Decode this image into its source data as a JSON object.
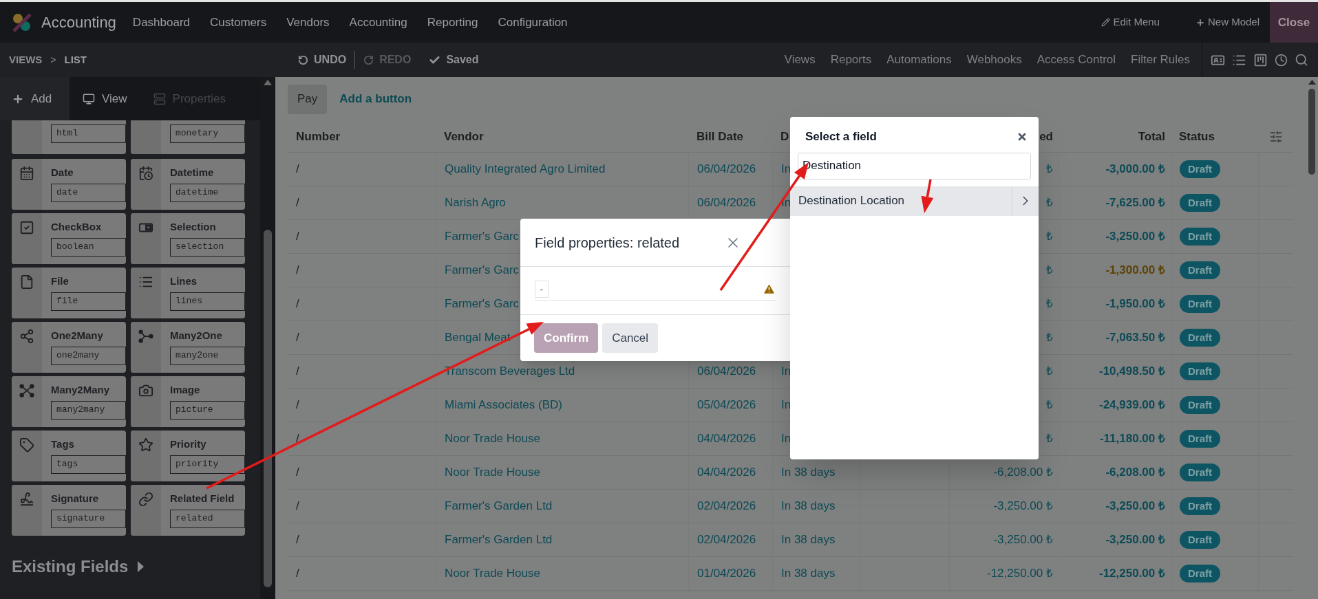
{
  "top_nav": {
    "app_name": "Accounting",
    "menu": [
      "Dashboard",
      "Customers",
      "Vendors",
      "Accounting",
      "Reporting",
      "Configuration"
    ],
    "edit_menu": "Edit Menu",
    "new_model": "New Model",
    "close": "Close"
  },
  "studio_bar": {
    "breadcrumb": [
      "VIEWS",
      "LIST"
    ],
    "separator": ">",
    "undo": {
      "label": "UNDO",
      "disabled": false
    },
    "redo": {
      "label": "REDO",
      "disabled": true
    },
    "status": "Saved",
    "links": [
      "Views",
      "Reports",
      "Automations",
      "Webhooks",
      "Access Control",
      "Filter Rules"
    ]
  },
  "sidebar": {
    "tabs": [
      {
        "label": "Add",
        "selected": true,
        "disabled": false
      },
      {
        "label": "View",
        "selected": false,
        "disabled": false
      },
      {
        "label": "Properties",
        "selected": false,
        "disabled": true
      }
    ],
    "fields": [
      {
        "type": "html"
      },
      {
        "type": "monetary"
      },
      {
        "label": "Date",
        "type": "date"
      },
      {
        "label": "Datetime",
        "type": "datetime"
      },
      {
        "label": "CheckBox",
        "type": "boolean"
      },
      {
        "label": "Selection",
        "type": "selection"
      },
      {
        "label": "File",
        "type": "file"
      },
      {
        "label": "Lines",
        "type": "lines"
      },
      {
        "label": "One2Many",
        "type": "one2many"
      },
      {
        "label": "Many2One",
        "type": "many2one"
      },
      {
        "label": "Many2Many",
        "type": "many2many"
      },
      {
        "label": "Image",
        "type": "picture"
      },
      {
        "label": "Tags",
        "type": "tags"
      },
      {
        "label": "Priority",
        "type": "priority"
      },
      {
        "label": "Signature",
        "type": "signature"
      },
      {
        "label": "Related Field",
        "type": "related"
      }
    ],
    "existing_fields": "Existing Fields"
  },
  "list": {
    "buttons": [
      "Pay"
    ],
    "add_button": "Add a button",
    "columns": [
      "Number",
      "Vendor",
      "Bill Date",
      "D",
      "ed",
      "Total",
      "Status"
    ],
    "rows": [
      {
        "number": "/",
        "vendor": "Quality Integrated Agro Limited",
        "bill_date": "06/04/2026",
        "due": "In",
        "untaxed": "₺",
        "total": "-3,000.00 ₺",
        "overdue": false,
        "status": "Draft"
      },
      {
        "number": "/",
        "vendor": "Narish Agro",
        "bill_date": "06/04/2026",
        "due": "In",
        "untaxed": "₺",
        "total": "-7,625.00 ₺",
        "overdue": false,
        "status": "Draft"
      },
      {
        "number": "/",
        "vendor": "Farmer's Garc",
        "untaxed": "₺",
        "total": "-3,250.00 ₺",
        "overdue": false,
        "status": "Draft"
      },
      {
        "number": "/",
        "vendor": "Farmer's Garc",
        "untaxed": "₺",
        "total": "-1,300.00 ₺",
        "overdue": true,
        "status": "Draft"
      },
      {
        "number": "/",
        "vendor": "Farmer's Garc",
        "untaxed": "₺",
        "total": "-1,950.00 ₺",
        "overdue": false,
        "status": "Draft"
      },
      {
        "number": "/",
        "vendor": "Bengal Meat",
        "untaxed": "₺",
        "total": "-7,063.50 ₺",
        "overdue": false,
        "status": "Draft"
      },
      {
        "number": "/",
        "vendor": "Transcom Beverages Ltd",
        "bill_date": "06/04/2026",
        "due": "In",
        "untaxed": "₺",
        "total": "-10,498.50 ₺",
        "overdue": false,
        "status": "Draft"
      },
      {
        "number": "/",
        "vendor": "Miami Associates (BD)",
        "bill_date": "05/04/2026",
        "due": "In",
        "untaxed": "₺",
        "total": "-24,939.00 ₺",
        "overdue": false,
        "status": "Draft"
      },
      {
        "number": "/",
        "vendor": "Noor Trade House",
        "bill_date": "04/04/2026",
        "due": "In",
        "untaxed": "₺",
        "total": "-11,180.00 ₺",
        "overdue": false,
        "status": "Draft"
      },
      {
        "number": "/",
        "vendor": "Noor Trade House",
        "bill_date": "04/04/2026",
        "due": "In 38 days",
        "untaxed": "-6,208.00 ₺",
        "total": "-6,208.00 ₺",
        "overdue": false,
        "status": "Draft"
      },
      {
        "number": "/",
        "vendor": "Farmer's Garden Ltd",
        "bill_date": "02/04/2026",
        "due": "In 38 days",
        "untaxed": "-3,250.00 ₺",
        "total": "-3,250.00 ₺",
        "overdue": false,
        "status": "Draft"
      },
      {
        "number": "/",
        "vendor": "Farmer's Garden Ltd",
        "bill_date": "02/04/2026",
        "due": "In 38 days",
        "untaxed": "-3,250.00 ₺",
        "total": "-3,250.00 ₺",
        "overdue": false,
        "status": "Draft"
      },
      {
        "number": "/",
        "vendor": "Noor Trade House",
        "bill_date": "01/04/2026",
        "due": "In 38 days",
        "untaxed": "-12,250.00 ₺",
        "total": "-12,250.00 ₺",
        "overdue": false,
        "status": "Draft"
      }
    ]
  },
  "field_properties_dialog": {
    "title": "Field properties: related",
    "value": "-",
    "confirm": {
      "label": "Confirm",
      "disabled": true
    },
    "cancel": "Cancel"
  },
  "field_selector": {
    "title": "Select a field",
    "search_value": "Destination",
    "results": [
      {
        "label": "Destination Location",
        "selected": true
      }
    ]
  }
}
